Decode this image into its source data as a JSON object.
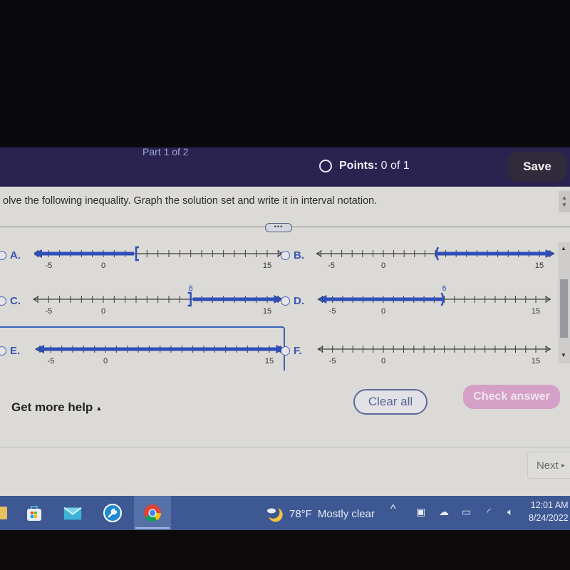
{
  "header": {
    "part": "Part 1 of 2",
    "points_label": "Points:",
    "points_value": "0 of 1",
    "save_label": "Save"
  },
  "question": {
    "text": "olve the following inequality. Graph the solution set and write it in interval notation.",
    "more_label": "•••"
  },
  "options": [
    {
      "letter": "A.",
      "solution": {
        "type": "left-ray",
        "endpoint": 3,
        "closed": true,
        "endpoint_label": ""
      }
    },
    {
      "letter": "B.",
      "solution": {
        "type": "right-ray",
        "endpoint": 5,
        "closed": false,
        "endpoint_label": ""
      }
    },
    {
      "letter": "C.",
      "solution": {
        "type": "right-ray",
        "endpoint": 8,
        "closed": true,
        "endpoint_label": "8"
      }
    },
    {
      "letter": "D.",
      "solution": {
        "type": "left-ray",
        "endpoint": 6,
        "closed": false,
        "endpoint_label": "6"
      }
    },
    {
      "letter": "E.",
      "solution": {
        "type": "all",
        "endpoint": null,
        "closed": null,
        "endpoint_label": ""
      }
    },
    {
      "letter": "F.",
      "solution": {
        "type": "none",
        "endpoint": null,
        "closed": null,
        "endpoint_label": ""
      }
    }
  ],
  "number_line": {
    "min": -6,
    "max": 16,
    "tick_step": 1,
    "labels": [
      "-5",
      "0",
      "15"
    ],
    "label_values": [
      -5,
      0,
      15
    ],
    "line_color": "#3a3a40",
    "solution_color": "#2f4fb8"
  },
  "footer": {
    "help_label": "Get more help",
    "help_arrow": "▲",
    "clear_label": "Clear all",
    "check_label": "Check answer",
    "next_label": "Next",
    "next_arrow": "▸"
  },
  "taskbar": {
    "weather_temp": "78°F",
    "weather_desc": "Mostly clear",
    "time": "12:01 AM",
    "date": "8/24/2022"
  },
  "colors": {
    "header_bg": "#2a2350",
    "accent": "#3a62b8",
    "check_button": "#d4a0c6"
  }
}
